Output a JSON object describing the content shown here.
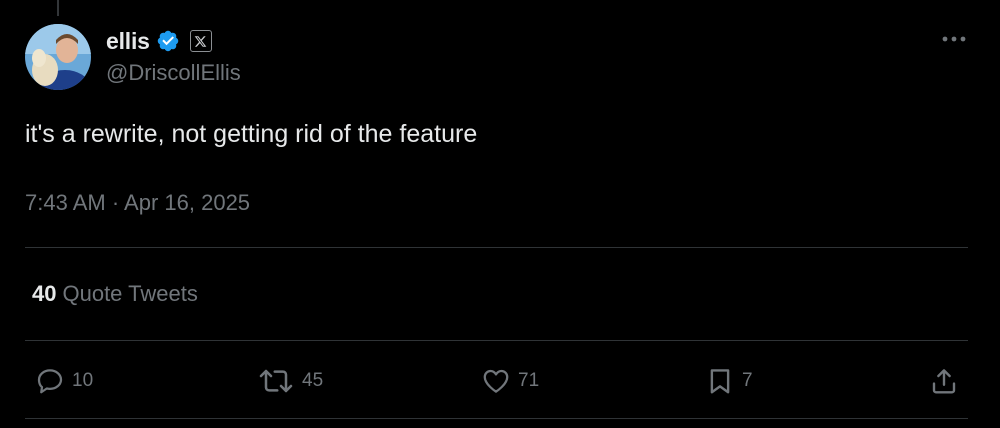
{
  "author": {
    "display_name": "ellis",
    "handle": "@DriscollEllis",
    "verified": true
  },
  "tweet": {
    "text": "it's a rewrite, not getting rid of the feature",
    "timestamp": "7:43 AM · Apr 16, 2025"
  },
  "quotes": {
    "count": "40",
    "label": "Quote Tweets"
  },
  "actions": {
    "reply_count": "10",
    "retweet_count": "45",
    "like_count": "71",
    "bookmark_count": "7"
  },
  "icons": {
    "verified": "verified-badge-icon",
    "platform": "x-logo-icon",
    "more": "more-icon",
    "reply": "reply-icon",
    "retweet": "retweet-icon",
    "like": "heart-icon",
    "bookmark": "bookmark-icon",
    "share": "share-icon"
  },
  "colors": {
    "background": "#000000",
    "primary_text": "#e7e9ea",
    "secondary_text": "#71767b",
    "divider": "#2f3336",
    "verified_blue": "#1d9bf0"
  }
}
